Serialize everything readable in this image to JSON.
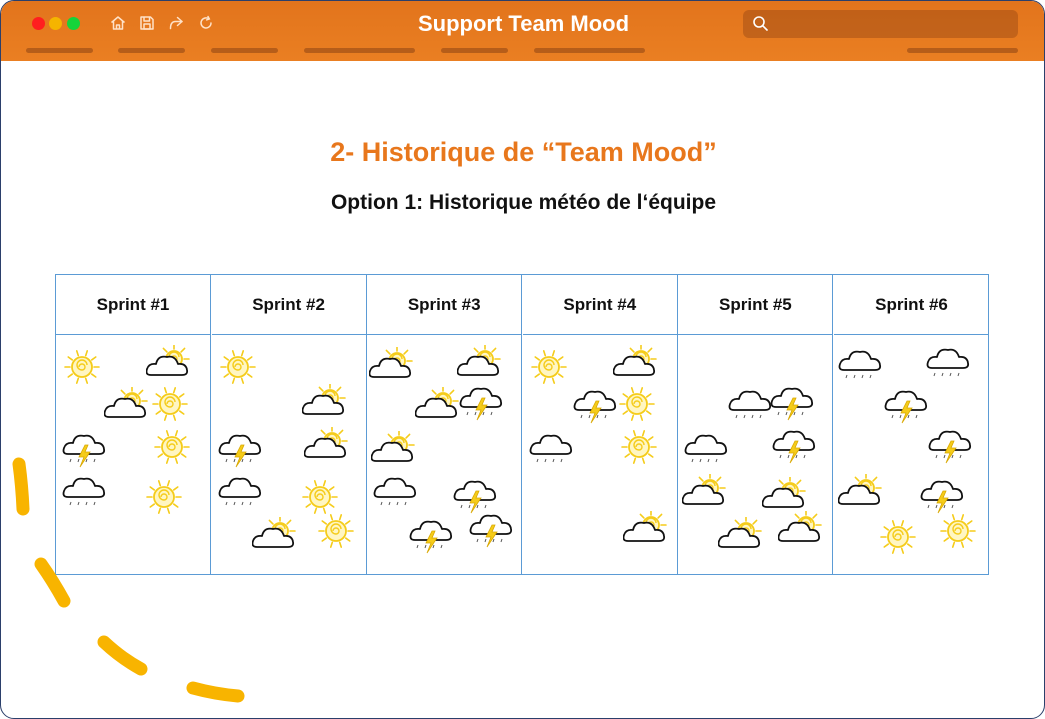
{
  "window": {
    "title": "Support Team Mood",
    "search_placeholder": ""
  },
  "toolbar": {
    "icons": [
      "home-icon",
      "save-icon",
      "share-icon",
      "refresh-icon"
    ]
  },
  "slide": {
    "title": "2- Historique de “Team Mood”",
    "subtitle": "Option 1: Historique météo de l‘équipe"
  },
  "sprints": [
    {
      "label": "Sprint #1",
      "moods": [
        "sun",
        "sun-cloud",
        "sun-cloud",
        "sun",
        "storm",
        "sun",
        "cloud",
        "sun"
      ]
    },
    {
      "label": "Sprint #2",
      "moods": [
        "sun-cloud",
        "storm",
        "sun-cloud",
        "cloud",
        "sun",
        "sun-cloud",
        "sun",
        "sun"
      ]
    },
    {
      "label": "Sprint #3",
      "moods": [
        "cloud",
        "storm",
        "storm",
        "storm",
        "sun-cloud",
        "sun-cloud",
        "sun-cloud",
        "storm",
        "sun-cloud"
      ]
    },
    {
      "label": "Sprint #4",
      "moods": [
        "sun-cloud",
        "sun",
        "sun-cloud",
        "storm",
        "sun",
        "cloud",
        "sun"
      ]
    },
    {
      "label": "Sprint #5",
      "moods": [
        "cloud",
        "storm",
        "cloud",
        "storm",
        "sun-cloud",
        "sun-cloud",
        "sun-cloud",
        "sun-cloud"
      ]
    },
    {
      "label": "Sprint #6",
      "moods": [
        "storm",
        "sun-cloud",
        "storm",
        "sun",
        "sun",
        "cloud",
        "cloud",
        "storm"
      ]
    }
  ],
  "colors": {
    "accent": "#e8771c",
    "table_border": "#5b9bd5",
    "sun": "#f5cc1a",
    "dash": "#f8b400"
  }
}
